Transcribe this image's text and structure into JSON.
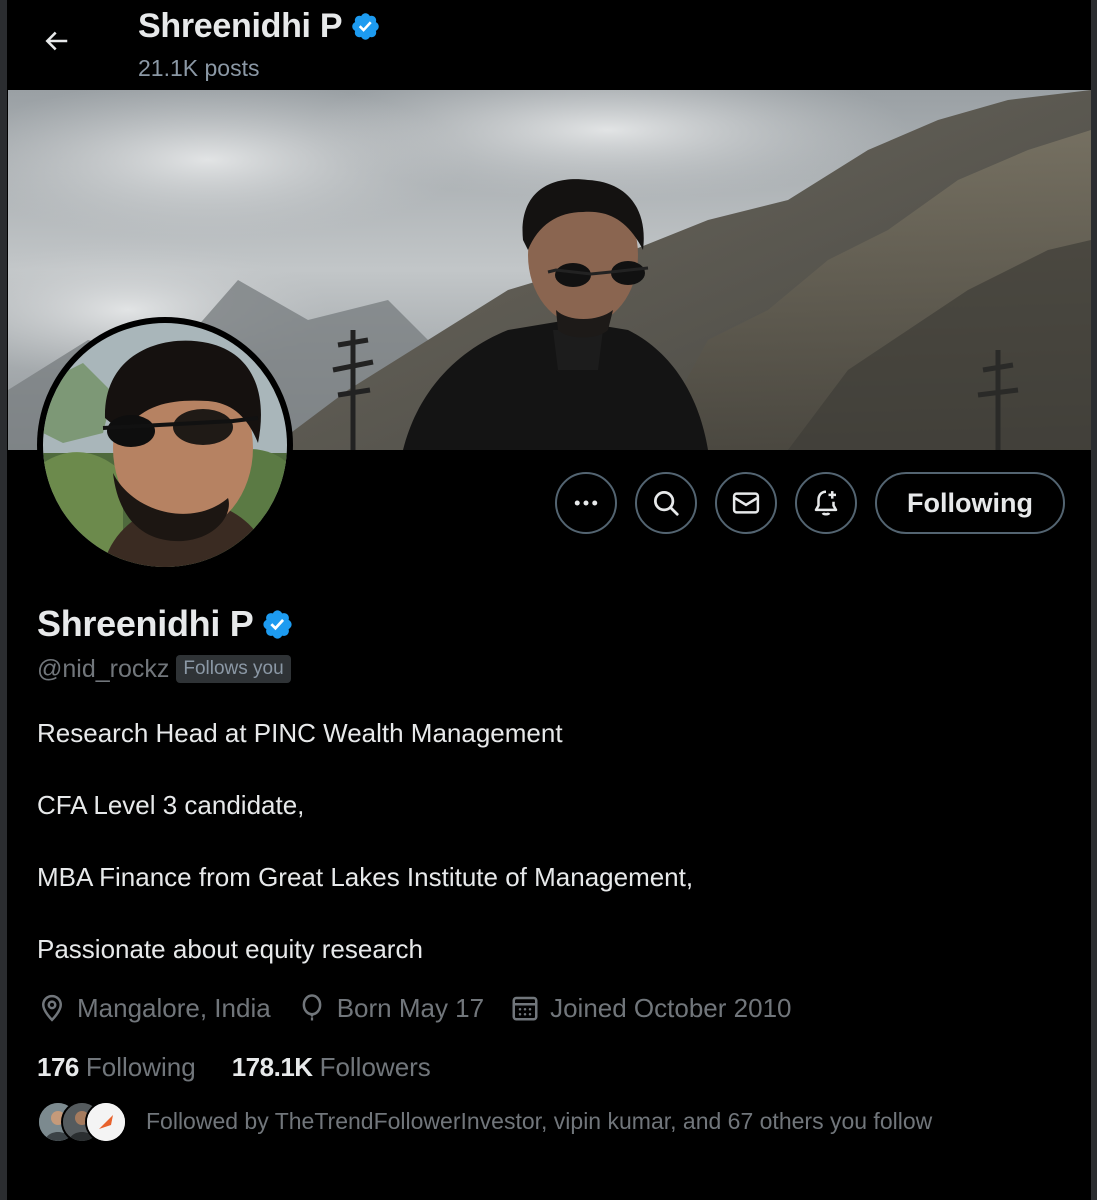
{
  "header": {
    "name": "Shreenidhi P",
    "posts": "21.1K posts"
  },
  "actions": {
    "following_label": "Following"
  },
  "profile": {
    "name": "Shreenidhi P",
    "handle": "@nid_rockz",
    "follows_you": "Follows you",
    "bio": [
      "Research Head at PINC Wealth Management",
      "CFA Level 3 candidate,",
      "MBA Finance from Great Lakes Institute of Management,",
      "Passionate about equity research"
    ],
    "location": "Mangalore, India",
    "born": "Born May 17",
    "joined": "Joined October 2010"
  },
  "stats": {
    "following_count": "176",
    "following_label": "Following",
    "followers_count": "178.1K",
    "followers_label": "Followers"
  },
  "followed_by": {
    "text": "Followed by TheTrendFollowerInvestor, vipin kumar, and 67 others you follow"
  },
  "colors": {
    "background": "#000000",
    "verified": "#1d9bf0",
    "text_primary": "#e7e9ea",
    "text_secondary": "#71767b",
    "border": "#536471"
  },
  "icons": {
    "back": "arrow-left-icon",
    "verified": "verified-badge-icon",
    "more": "more-dots-icon",
    "search": "search-icon",
    "message": "envelope-icon",
    "notify": "bell-plus-icon",
    "location": "location-pin-icon",
    "born": "balloon-icon",
    "joined": "calendar-icon"
  }
}
